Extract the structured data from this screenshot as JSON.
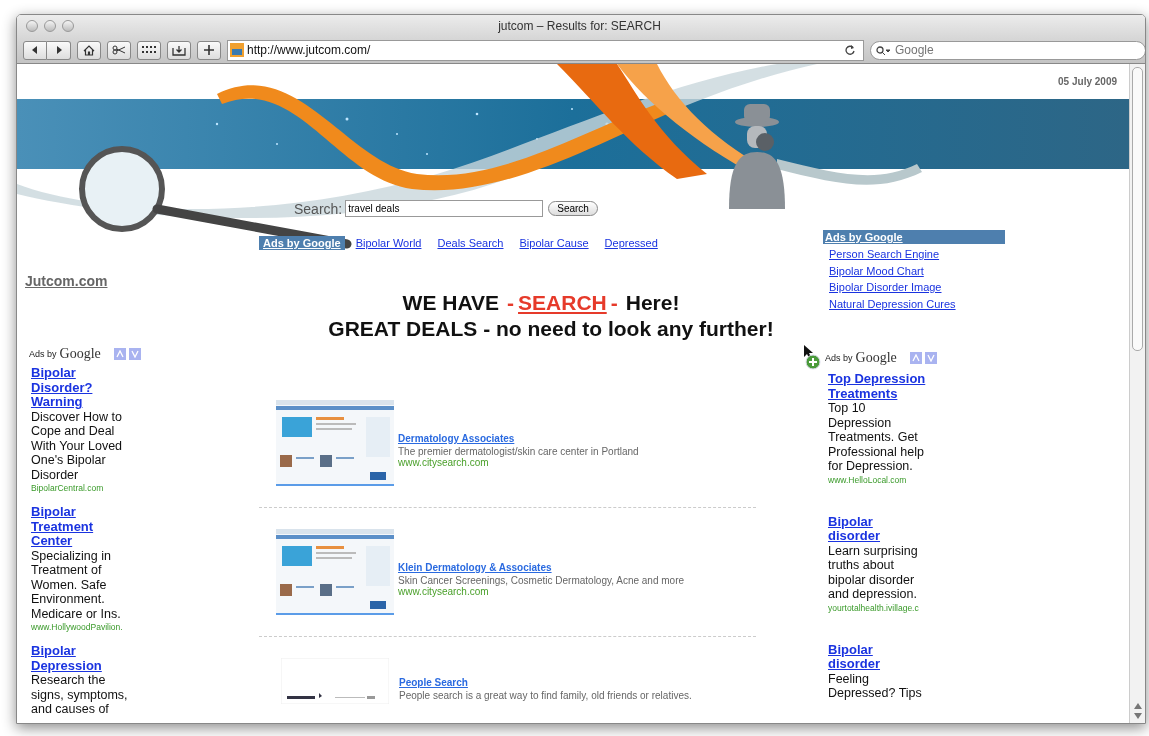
{
  "window": {
    "title": "jutcom – Results for: SEARCH"
  },
  "toolbar": {
    "url": "http://www.jutcom.com/",
    "search_placeholder": "Google"
  },
  "page": {
    "date": "05 July 2009",
    "search": {
      "label": "Search:",
      "value": "travel deals",
      "button": "Search"
    },
    "site_name": "Jutcom.com",
    "link_bar": {
      "badge": "Ads by Google",
      "links": [
        "Bipolar World",
        "Deals Search",
        "Bipolar Cause",
        "Depressed"
      ]
    },
    "headline": {
      "line1": [
        {
          "text": "WE HAVE",
          "kind": "plain"
        },
        {
          "text": "-",
          "kind": "accent"
        },
        {
          "text": "SEARCH",
          "kind": "link"
        },
        {
          "text": "-",
          "kind": "accent"
        },
        {
          "text": "Here!",
          "kind": "plain"
        }
      ],
      "line2": "GREAT DEALS - no need to look any further!"
    },
    "results": [
      {
        "title": "Dermatology Associates",
        "description": "The premier dermatologist/skin care center in Portland",
        "url": "www.citysearch.com",
        "kind": "page"
      },
      {
        "title": "Klein Dermatology & Associates",
        "description": "Skin Cancer Screenings, Cosmetic Dermatology, Acne and more",
        "url": "www.citysearch.com",
        "kind": "page"
      },
      {
        "title": "People Search",
        "description": "People search is a great way to find family, old friends or relatives.",
        "kind": "logo"
      }
    ],
    "left_ads": {
      "prefix": "Ads by",
      "brand": "Google",
      "ads": [
        {
          "title": "Bipolar Disorder? Warning",
          "text": "Discover How to Cope and Deal With Your Loved One's Bipolar Disorder",
          "url": "BipolarCentral.com"
        },
        {
          "title": "Bipolar Treatment Center",
          "text": "Specializing in Treatment of Women. Safe Environment. Medicare or Ins.",
          "url": "www.HollywoodPavilion."
        },
        {
          "title": "Bipolar Depression",
          "text": "Research the signs, symptoms, and causes of"
        }
      ]
    },
    "right_links": {
      "header": "Ads by Google",
      "links": [
        "Person Search Engine",
        "Bipolar Mood Chart",
        "Bipolar Disorder Image",
        "Natural Depression Cures"
      ]
    },
    "right_ads": {
      "prefix": "Ads by",
      "brand": "Google",
      "ads": [
        {
          "title": "Top Depression Treatments",
          "text": "Top 10 Depression Treatments. Get Professional help for Depression.",
          "url": "www.HelloLocal.com"
        },
        {
          "title": "Bipolar disorder",
          "text": "Learn surprising truths about bipolar disorder and depression.",
          "url": "yourtotalhealth.ivillage.c"
        },
        {
          "title": "Bipolar disorder",
          "text": "Feeling Depressed? Tips"
        }
      ]
    }
  }
}
